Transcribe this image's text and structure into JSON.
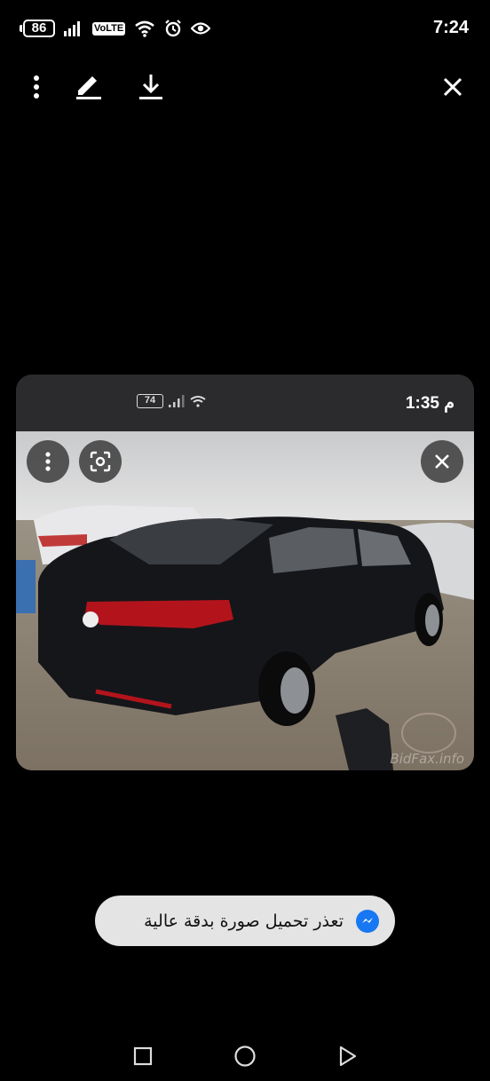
{
  "status_bar": {
    "battery_level": "86",
    "volte": "VoLTE",
    "time": "7:24"
  },
  "toolbar": {
    "icons": [
      "more-vert-icon",
      "edit-pencil-icon",
      "download-icon",
      "close-icon"
    ]
  },
  "shared_image": {
    "inner_status": {
      "time": "1:35 م",
      "battery_level": "74"
    },
    "watermark": "BidFax.info"
  },
  "toast": {
    "message": "تعذر تحميل صورة بدقة عالية",
    "app_icon": "messenger-icon"
  },
  "nav_bar": {
    "icons": [
      "recents-square-icon",
      "home-circle-icon",
      "back-triangle-icon"
    ]
  },
  "colors": {
    "background": "#000000",
    "toast_bg": "#e4e4e4",
    "messenger_blue": "#1877f2"
  }
}
